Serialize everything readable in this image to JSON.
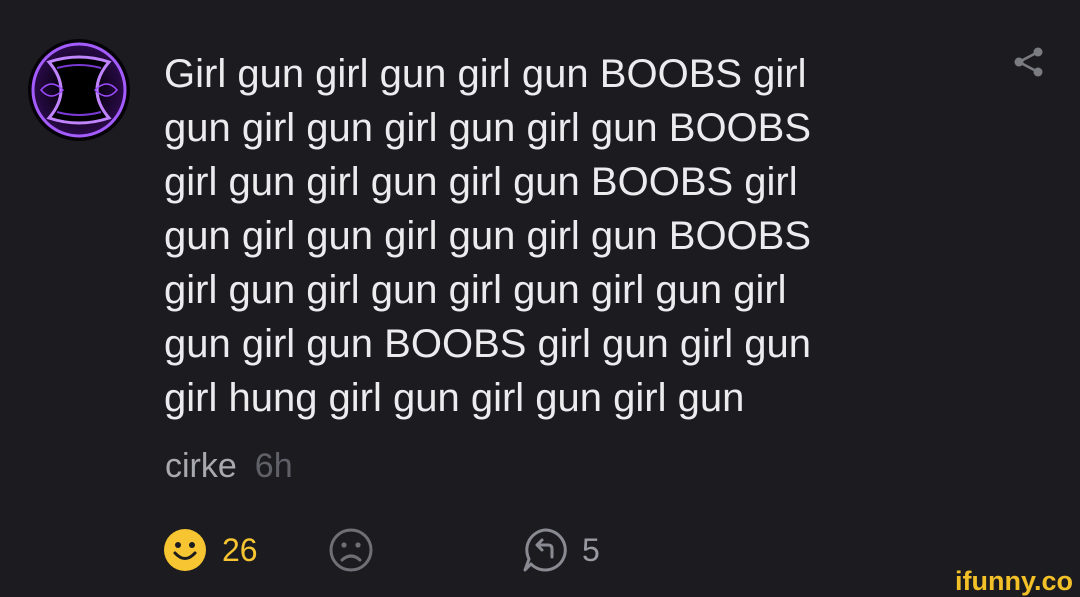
{
  "comment": {
    "avatar_icon": "purple-vortex-avatar-icon",
    "text": "Girl gun girl gun girl gun BOOBS girl\ngun girl gun girl gun girl gun BOOBS\ngirl gun girl gun girl gun BOOBS girl\ngun girl gun girl gun girl gun BOOBS\ngirl gun girl gun girl gun girl gun girl\ngun girl gun BOOBS girl gun girl gun\ngirl hung girl gun girl gun girl gun",
    "username": "cirke",
    "time": "6h",
    "share_icon": "share-icon"
  },
  "actions": {
    "smile_count": "26",
    "reply_count": "5"
  },
  "watermark": "ifunny.co",
  "colors": {
    "background": "#1c1c20",
    "text": "#ececef",
    "smile": "#f6c531",
    "avatar_accent": "#9b4dff"
  }
}
